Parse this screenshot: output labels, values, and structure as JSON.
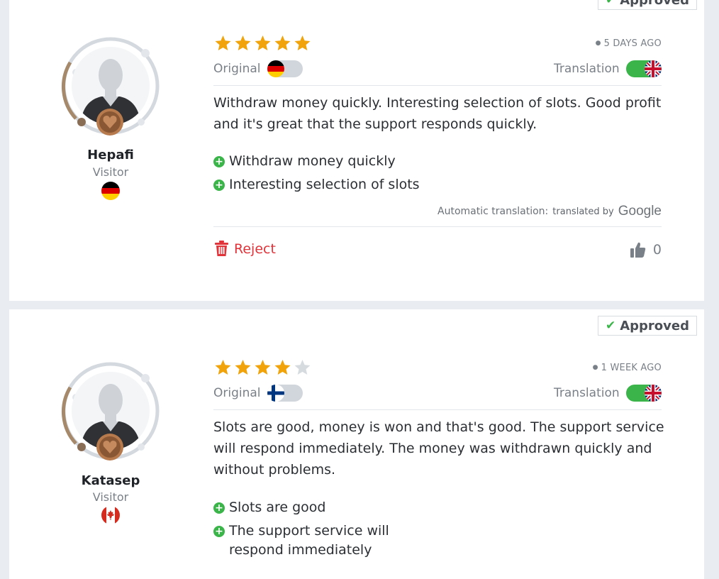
{
  "colors": {
    "star": "#f0a30a",
    "star_empty": "#d6dbe0",
    "approved_check": "#3bb54a",
    "reject": "#e0333a",
    "toggle_on": "#3bb54a",
    "toggle_off": "#d1d6dc"
  },
  "reviews": [
    {
      "status": "Approved",
      "user_name": "Hepafi",
      "user_role": "Visitor",
      "user_flag_icon": "germany-flag-icon",
      "rating": 5,
      "max_rating": 5,
      "date": "5 DAYS AGO",
      "original_label": "Original",
      "original_flag_icon": "germany-flag-icon",
      "translation_label": "Translation",
      "translation_flag_icon": "uk-flag-icon",
      "text": "Withdraw money quickly. Interesting selection of slots. Good profit and it's great that the support responds quickly.",
      "pros": [
        "Withdraw money quickly",
        "Interesting selection of slots"
      ],
      "auto_translation_label": "Automatic translation:",
      "translated_by": "translated by",
      "translator": "Google",
      "reject_label": "Reject",
      "likes": "0"
    },
    {
      "status": "Approved",
      "user_name": "Katasep",
      "user_role": "Visitor",
      "user_flag_icon": "canada-flag-icon",
      "rating": 4,
      "max_rating": 5,
      "date": "1 WEEK AGO",
      "original_label": "Original",
      "original_flag_icon": "finland-flag-icon",
      "translation_label": "Translation",
      "translation_flag_icon": "uk-flag-icon",
      "text": "Slots are good, money is won and that's good. The support service will respond immediately. The money was withdrawn quickly and without problems.",
      "pros": [
        "Slots are good",
        "The support service will respond immediately"
      ]
    }
  ]
}
